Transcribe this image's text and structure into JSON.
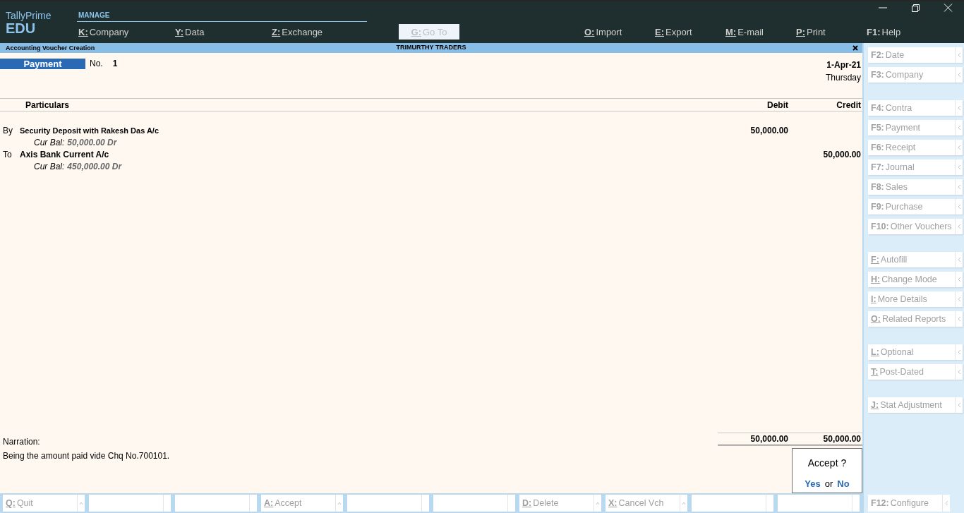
{
  "app": {
    "name": "TallyPrime",
    "edition": "EDU"
  },
  "menu": {
    "section": "MANAGE",
    "items": [
      {
        "kind": "menu",
        "key": "K:",
        "label": "Company",
        "underline": true
      },
      {
        "kind": "menu",
        "key": "Y:",
        "label": "Data",
        "underline": true
      },
      {
        "kind": "menu",
        "key": "Z:",
        "label": "Exchange",
        "underline": true
      },
      {
        "kind": "button",
        "key": "G:",
        "label": "Go To",
        "underline": true
      },
      {
        "kind": "menu",
        "key": "O:",
        "label": "Import",
        "underline": true
      },
      {
        "kind": "menu",
        "key": "E:",
        "label": "Export",
        "underline": true
      },
      {
        "kind": "menu",
        "key": "M:",
        "label": "E-mail",
        "underline": true
      },
      {
        "kind": "menu",
        "key": "P:",
        "label": "Print",
        "underline": true
      },
      {
        "kind": "menu",
        "key": "F1:",
        "label": "Help",
        "underline": false
      }
    ]
  },
  "screen": {
    "title": "Accounting Voucher Creation",
    "company": "TRIMURTHY TRADERS"
  },
  "voucher": {
    "type": "Payment",
    "no_label": "No.",
    "number": "1",
    "date": "1-Apr-21",
    "day": "Thursday",
    "columns": [
      "Particulars",
      "Debit",
      "Credit"
    ],
    "entries": [
      {
        "prefix": "By",
        "account": "Security Deposit with Rakesh Das A/c",
        "balance_label": "Cur Bal:",
        "balance": "50,000.00 Dr",
        "debit": "50,000.00"
      },
      {
        "prefix": "To",
        "account": "Axis Bank Current A/c",
        "balance_label": "Cur Bal:",
        "balance": "450,000.00 Dr",
        "credit": "50,000.00"
      }
    ],
    "narration_label": "Narration:",
    "narration": "Being the amount paid vide Chq No.700101.",
    "total_debit": "50,000.00",
    "total_credit": "50,000.00"
  },
  "dialog": {
    "question": "Accept ?",
    "yes": "Yes",
    "or": "or",
    "no": "No"
  },
  "side_groups": [
    [
      {
        "key": "F2:",
        "label": "Date",
        "underline": false
      },
      {
        "key": "F3:",
        "label": "Company",
        "underline": false
      }
    ],
    [
      {
        "key": "F4:",
        "label": "Contra",
        "underline": false
      },
      {
        "key": "F5:",
        "label": "Payment",
        "underline": false
      },
      {
        "key": "F6:",
        "label": "Receipt",
        "underline": false
      },
      {
        "key": "F7:",
        "label": "Journal",
        "underline": false
      },
      {
        "key": "F8:",
        "label": "Sales",
        "underline": false
      },
      {
        "key": "F9:",
        "label": "Purchase",
        "underline": false
      },
      {
        "key": "F10:",
        "label": "Other Vouchers",
        "underline": false
      }
    ],
    [
      {
        "key": "F:",
        "label": "Autofill",
        "underline": true
      },
      {
        "key": "H:",
        "label": "Change Mode",
        "underline": true
      },
      {
        "key": "I:",
        "label": "More Details",
        "underline": true
      },
      {
        "key": "O:",
        "label": "Related Reports",
        "underline": true
      }
    ],
    [
      {
        "key": "L:",
        "label": "Optional",
        "underline": true
      },
      {
        "key": "T:",
        "label": "Post-Dated",
        "underline": true
      }
    ],
    [
      {
        "key": "J:",
        "label": "Stat Adjustment",
        "underline": true
      }
    ]
  ],
  "bottom": [
    {
      "kind": "key",
      "key": "Q:",
      "label": "Quit",
      "underline": true
    },
    {
      "kind": "blank"
    },
    {
      "kind": "blank"
    },
    {
      "kind": "key",
      "key": "A:",
      "label": "Accept",
      "underline": true
    },
    {
      "kind": "blank"
    },
    {
      "kind": "blank"
    },
    {
      "kind": "key",
      "key": "D:",
      "label": "Delete",
      "underline": true
    },
    {
      "kind": "key",
      "key": "X:",
      "label": "Cancel Vch",
      "underline": true
    },
    {
      "kind": "blank"
    },
    {
      "kind": "blank"
    }
  ],
  "bottom_right": {
    "key": "F12:",
    "label": "Configure",
    "underline": false
  }
}
